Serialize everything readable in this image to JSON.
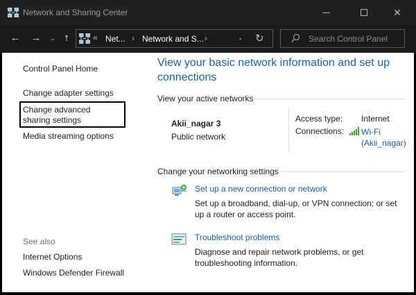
{
  "window": {
    "title": "Network and Sharing Center",
    "minimize_glyph": "",
    "close_glyph": "✕",
    "app_icon": "network-center-icon"
  },
  "addressbar": {
    "back_glyph": "←",
    "forward_glyph": "→",
    "recent_glyph": "⌄",
    "up_glyph": "↑",
    "overflow_glyph": "«",
    "crumbs": [
      "Net...",
      "Network and S..."
    ],
    "separator": "›",
    "dropdown_glyph": "⌄",
    "refresh_glyph": "↻",
    "search_placeholder": "Search Control Panel"
  },
  "sidebar": {
    "links": [
      "Control Panel Home",
      "Change adapter settings",
      "Change advanced sharing settings",
      "Media streaming options"
    ],
    "see_also_label": "See also",
    "see_also_links": [
      "Internet Options",
      "Windows Defender Firewall"
    ]
  },
  "main": {
    "title": "View your basic network information and set up connections",
    "active_networks_label": "View your active networks",
    "network": {
      "name": "Akii_nagar 3",
      "type": "Public network",
      "access_type_label": "Access type:",
      "access_type_value": "Internet",
      "connections_label": "Connections:",
      "connections_value": "Wi-Fi (Akii_nagar)"
    },
    "change_settings_label": "Change your networking settings",
    "tasks": [
      {
        "link": "Set up a new connection or network",
        "description": "Set up a broadband, dial-up, or VPN connection; or set up a router or access point.",
        "icon": "new-connection-icon"
      },
      {
        "link": "Troubleshoot problems",
        "description": "Diagnose and repair network problems, or get troubleshooting information.",
        "icon": "troubleshoot-icon"
      }
    ]
  },
  "colors": {
    "title_blue": "#1c5ea9",
    "titlebar_bg": "#202020",
    "wifi_green": "#3aa53a"
  }
}
